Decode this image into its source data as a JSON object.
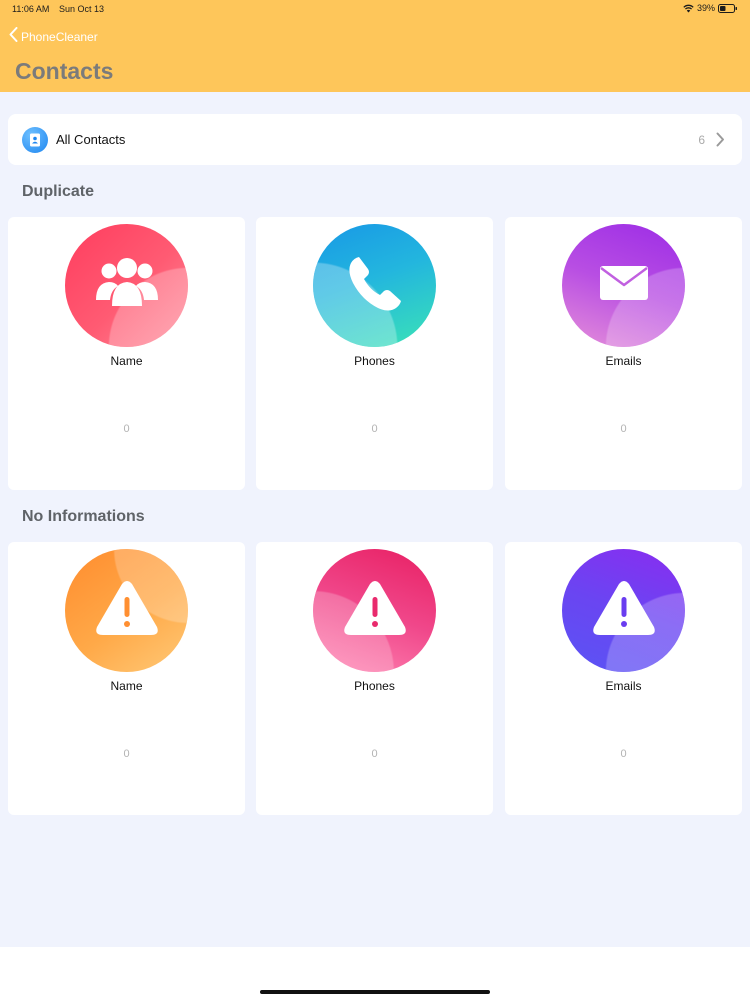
{
  "status_bar": {
    "time": "11:06 AM",
    "date": "Sun Oct 13",
    "battery": "39%"
  },
  "nav": {
    "back_label": "PhoneCleaner",
    "title": "Contacts"
  },
  "all_contacts": {
    "label": "All Contacts",
    "count": "6",
    "icon": "contact-book-icon"
  },
  "duplicate": {
    "title": "Duplicate",
    "cards": [
      {
        "label": "Name",
        "count": "0",
        "icon": "users-icon",
        "colors": [
          "#ff4d6d",
          "#ff7a8a"
        ]
      },
      {
        "label": "Phones",
        "count": "0",
        "icon": "phone-icon",
        "colors": [
          "#1fa9e6",
          "#3de0b8"
        ]
      },
      {
        "label": "Emails",
        "count": "0",
        "icon": "mail-icon",
        "colors": [
          "#b044e8",
          "#e07ad8"
        ]
      }
    ]
  },
  "no_info": {
    "title": "No Informations",
    "cards": [
      {
        "label": "Name",
        "count": "0",
        "icon": "warning-icon",
        "colors": [
          "#ff9a3c",
          "#ffc36b"
        ]
      },
      {
        "label": "Phones",
        "count": "0",
        "icon": "warning-icon",
        "colors": [
          "#ee3b7c",
          "#ff7fae"
        ]
      },
      {
        "label": "Emails",
        "count": "0",
        "icon": "warning-icon",
        "colors": [
          "#5b4df5",
          "#b56af2"
        ]
      }
    ]
  },
  "colors": {
    "header": "#fec65a",
    "background": "#f0f3fd"
  }
}
